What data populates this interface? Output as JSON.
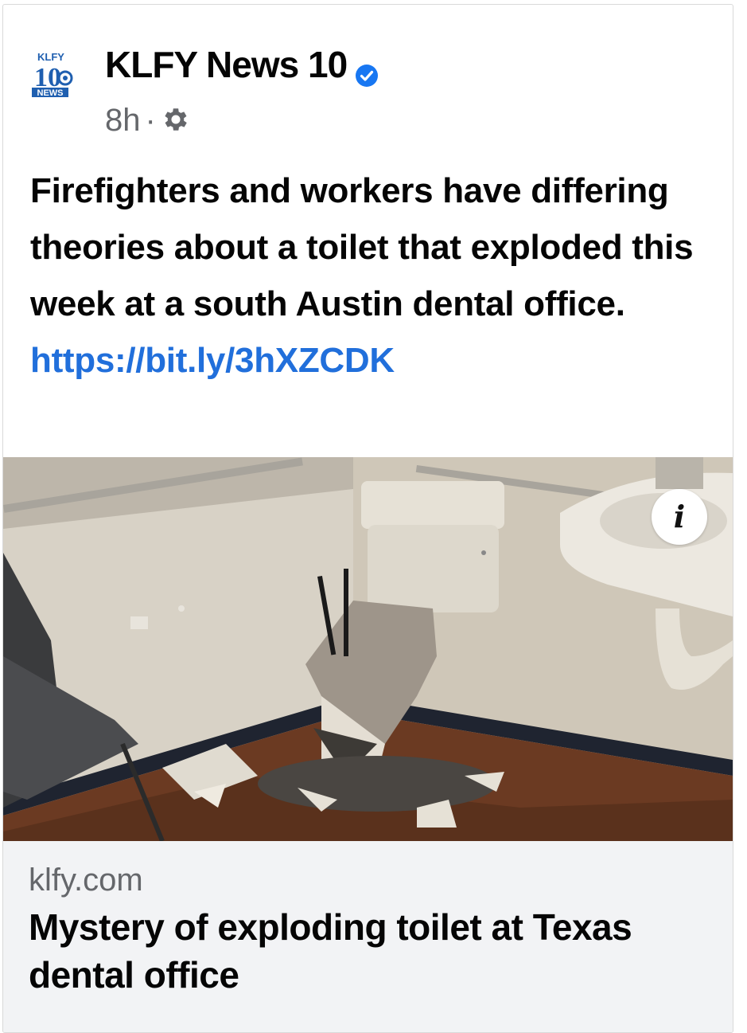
{
  "post": {
    "page_name": "KLFY News 10",
    "logo_text_top": "KLFY",
    "logo_text_number": "10",
    "logo_text_bottom": "NEWS",
    "time": "8h",
    "separator": "·",
    "text": "Firefighters and workers have differing theories about a toilet that exploded this week at a south Austin dental office.",
    "link_text": "https://bit.ly/3hXZCDK"
  },
  "image": {
    "info_button_label": "i"
  },
  "link_preview": {
    "domain": "klfy.com",
    "title": "Mystery of exploding toilet at Texas dental office"
  },
  "colors": {
    "link": "#216fdb",
    "verified": "#1877f2",
    "meta": "#65676b",
    "preview_bg": "#f2f3f5"
  },
  "icons": {
    "verified": "verified-badge-icon",
    "audience": "gear-icon",
    "info": "info-icon"
  }
}
